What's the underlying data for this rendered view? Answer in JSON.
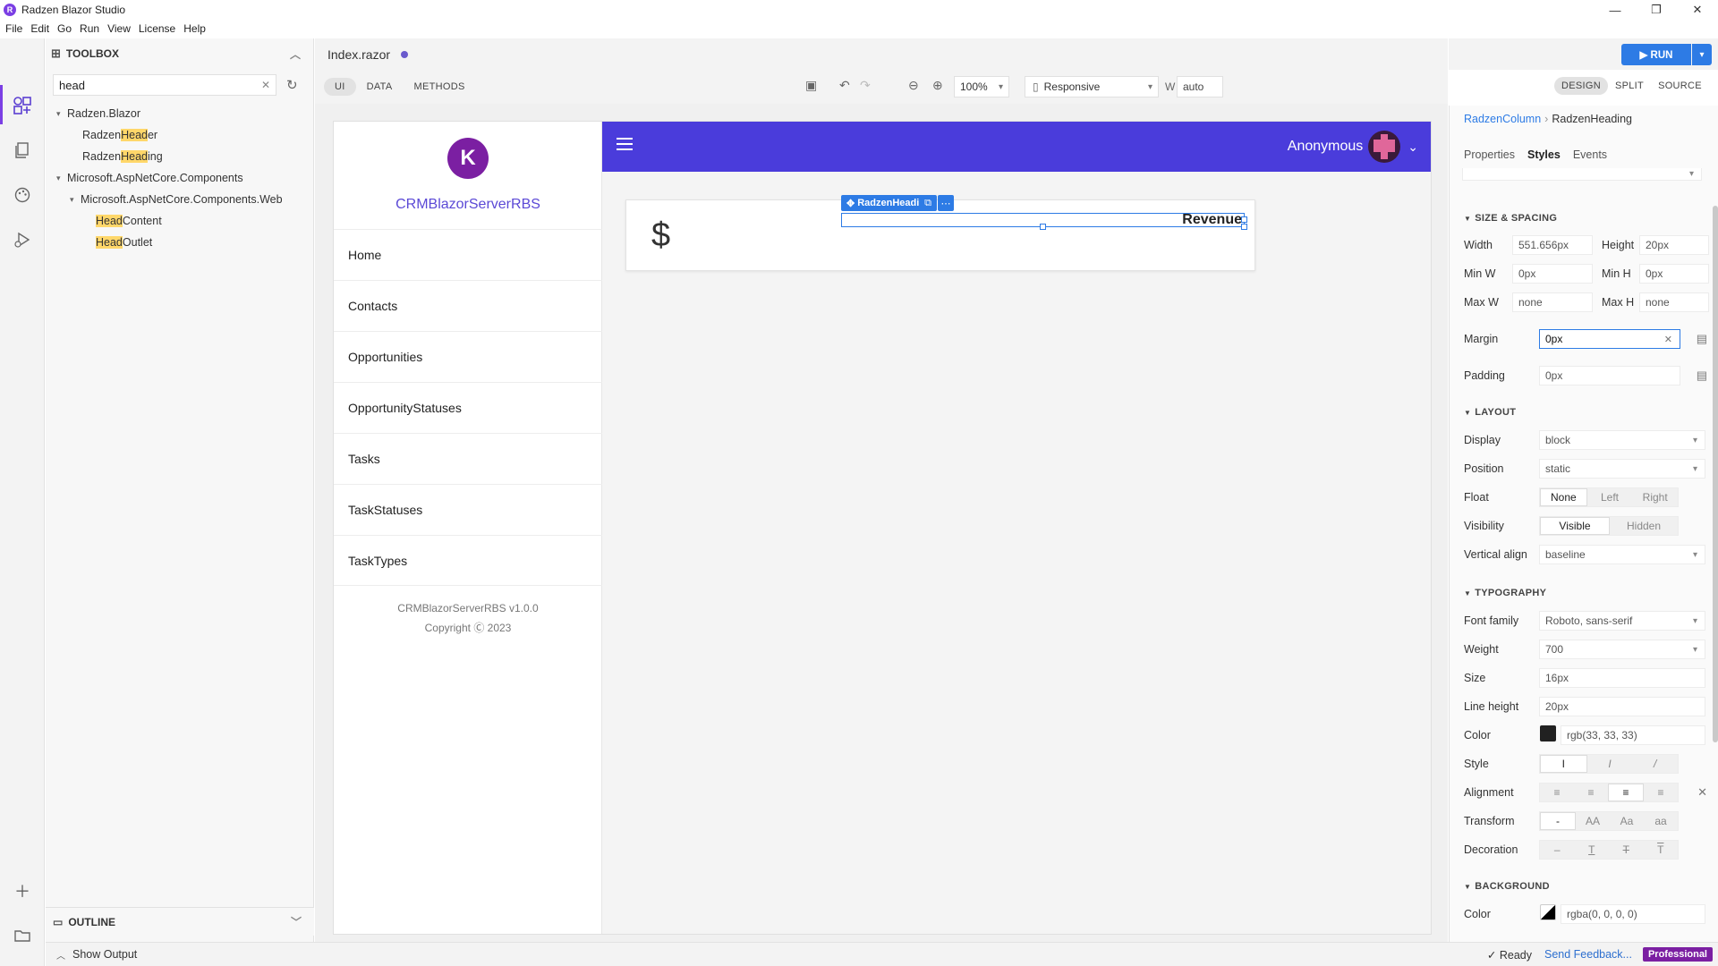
{
  "window": {
    "title": "Radzen Blazor Studio",
    "controls": [
      "—",
      "❐",
      "✕"
    ]
  },
  "menu": [
    "File",
    "Edit",
    "Go",
    "Run",
    "View",
    "License",
    "Help"
  ],
  "toolbox": {
    "title": "TOOLBOX",
    "search_value": "head",
    "tree": [
      {
        "level": 0,
        "caret": "▾",
        "pre": "Radzen.Blazor",
        "hl": "",
        "post": ""
      },
      {
        "level": 1,
        "caret": "",
        "pre": "Radzen",
        "hl": "Head",
        "post": "er"
      },
      {
        "level": 1,
        "caret": "",
        "pre": "Radzen",
        "hl": "Head",
        "post": "ing"
      },
      {
        "level": 0,
        "caret": "▾",
        "pre": "Microsoft.AspNetCore.Components",
        "hl": "",
        "post": ""
      },
      {
        "level": 1,
        "caret": "▾",
        "pre": "Microsoft.AspNetCore.Components.Web",
        "hl": "",
        "post": ""
      },
      {
        "level": 2,
        "caret": "",
        "pre": "",
        "hl": "Head",
        "post": "Content"
      },
      {
        "level": 2,
        "caret": "",
        "pre": "",
        "hl": "Head",
        "post": "Outlet"
      }
    ]
  },
  "outline": {
    "title": "OUTLINE"
  },
  "status": {
    "show_output": "Show Output",
    "ready": "✓  Ready",
    "feedback": "Send Feedback...",
    "edition": "Professional"
  },
  "editor": {
    "file_tab": "Index.razor",
    "mode_tabs": [
      "UI",
      "DATA",
      "METHODS"
    ],
    "zoom": "100%",
    "device": "Responsive",
    "width_label": "W",
    "width_value": "auto"
  },
  "app": {
    "brand": "CRMBlazorServerRBS",
    "nav": [
      "Home",
      "Contacts",
      "Opportunities",
      "OpportunityStatuses",
      "Tasks",
      "TaskStatuses",
      "TaskTypes"
    ],
    "footer_version": "CRMBlazorServerRBS v1.0.0",
    "footer_copyright": "Copyright Ⓒ 2023",
    "user_name": "Anonymous",
    "card_symbol": "$",
    "heading_text": "Revenue",
    "selected_component": "RadzenHeading"
  },
  "run_button": "▶ RUN",
  "view_tabs": [
    "DESIGN",
    "SPLIT",
    "SOURCE"
  ],
  "properties": {
    "breadcrumb": {
      "parent": "RadzenColumn",
      "current": "RadzenHeading"
    },
    "tabs": [
      "Properties",
      "Styles",
      "Events"
    ],
    "sections": {
      "size": "SIZE & SPACING",
      "layout": "LAYOUT",
      "typography": "TYPOGRAPHY",
      "background": "BACKGROUND"
    },
    "size": {
      "width_label": "Width",
      "width": "551.656px",
      "height_label": "Height",
      "height": "20px",
      "minw_label": "Min W",
      "minw": "0px",
      "minh_label": "Min H",
      "minh": "0px",
      "maxw_label": "Max W",
      "maxw": "none",
      "maxh_label": "Max H",
      "maxh": "none",
      "margin_label": "Margin",
      "margin": "0px",
      "padding_label": "Padding",
      "padding": "0px"
    },
    "layout": {
      "display_label": "Display",
      "display": "block",
      "position_label": "Position",
      "position": "static",
      "float_label": "Float",
      "float_options": [
        "None",
        "Left",
        "Right"
      ],
      "visibility_label": "Visibility",
      "visibility_options": [
        "Visible",
        "Hidden"
      ],
      "valign_label": "Vertical align",
      "valign": "baseline"
    },
    "typography": {
      "family_label": "Font family",
      "family": "Roboto, sans-serif",
      "weight_label": "Weight",
      "weight": "700",
      "size_label": "Size",
      "size": "16px",
      "lineheight_label": "Line height",
      "lineheight": "20px",
      "color_label": "Color",
      "color": "rgb(33, 33, 33)",
      "color_hex": "#212121",
      "style_label": "Style",
      "align_label": "Alignment",
      "transform_label": "Transform",
      "transform_options": [
        "-",
        "AA",
        "Aa",
        "aa"
      ],
      "decoration_label": "Decoration"
    },
    "background": {
      "color_label": "Color",
      "color": "rgba(0, 0, 0, 0)"
    }
  },
  "colors": {
    "accent": "#2d7be5",
    "header": "#4a3cdb",
    "brand_text": "#5b49d6",
    "highlight": "#ffd76a",
    "pro_badge": "#7b1fa2"
  }
}
